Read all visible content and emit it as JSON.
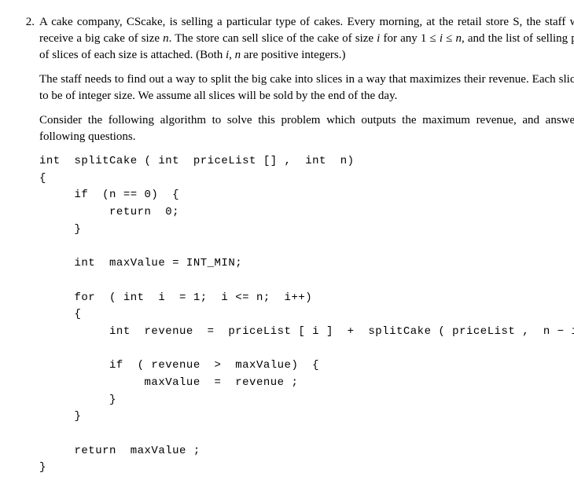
{
  "problem": {
    "number": "2.",
    "para1_a": "A cake company, CScake, is selling a particular type of cakes. Every morning, at the retail store S, the staff would receive a big cake of size ",
    "n1": "n",
    "para1_b": ". The store can sell slice of the cake of size ",
    "i1": "i",
    "para1_c": " for any 1 ≤ ",
    "i2": "i",
    "para1_d": " ≤ ",
    "n2": "n",
    "para1_e": ", and the list of selling prices of slices of each size is attached. (Both ",
    "i3": "i",
    "comma": ", ",
    "n3": "n",
    "para1_f": " are positive integers.)",
    "para2": "The staff needs to find out a way to split the big cake into slices in a way that maximizes their revenue. Each slice has to be of integer size. We assume all slices will be sold by the end of the day.",
    "para3": "Consider the following algorithm to solve this problem which outputs the maximum revenue, and answer the following questions."
  },
  "code": "int  splitCake ( int  priceList [] ,  int  n)\n{\n     if  (n == 0)  {\n          return  0;\n     }\n\n     int  maxValue = INT_MIN;\n\n     for  ( int  i  = 1;  i <= n;  i++)\n     {\n          int  revenue  =  priceList [ i ]  +  splitCake ( priceList ,  n − i );\n\n          if  ( revenue  >  maxValue)  {\n               maxValue  =  revenue ;\n          }\n     }\n\n     return  maxValue ;\n}"
}
